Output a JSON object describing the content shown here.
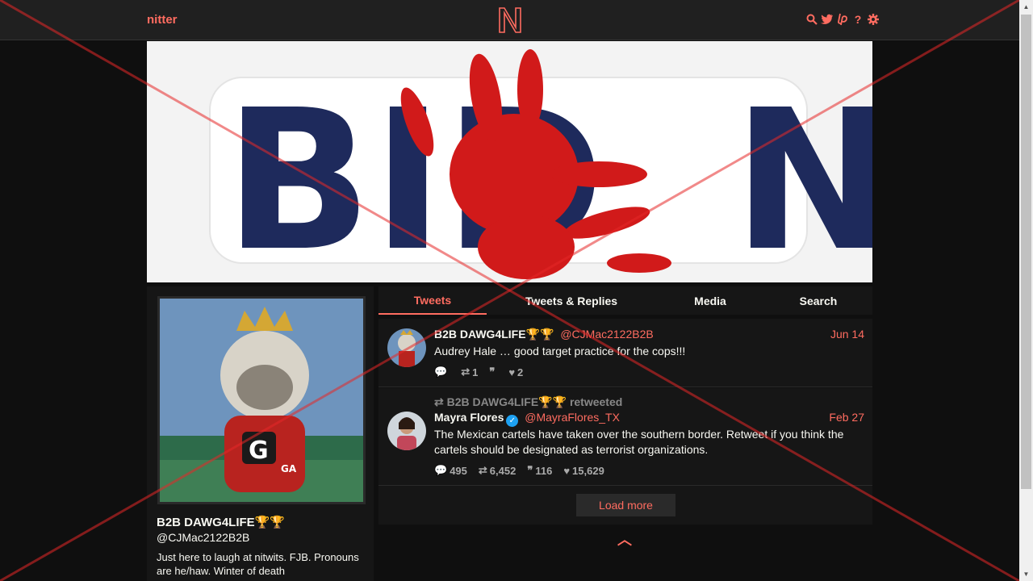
{
  "nav": {
    "brand": "nitter",
    "icons": [
      "search-icon",
      "rss-icon",
      "liberapay-icon",
      "about-icon",
      "settings-icon"
    ],
    "help_glyph": "?"
  },
  "banner": {
    "text_left": "BID",
    "text_right": "N"
  },
  "profile": {
    "fullname": "B2B DAWG4LIFE🏆🏆",
    "username": "@CJMac2122B2B",
    "bio": "Just here to laugh at nitwits. FJB. Pronouns are he/haw. Winter of death",
    "avatar_letters": "GA"
  },
  "tabs": [
    {
      "label": "Tweets",
      "active": true
    },
    {
      "label": "Tweets & Replies",
      "active": false
    },
    {
      "label": "Media",
      "active": false
    },
    {
      "label": "Search",
      "active": false
    }
  ],
  "tweets": [
    {
      "fullname": "B2B DAWG4LIFE🏆🏆",
      "username": "@CJMac2122B2B",
      "date": "Jun 14",
      "text": "Audrey Hale … good target practice for the cops!!!",
      "replies": "",
      "retweets": "1",
      "quotes": "",
      "likes": "2"
    },
    {
      "retweet_header": "B2B DAWG4LIFE🏆🏆 retweeted",
      "fullname": "Mayra Flores",
      "username": "@MayraFlores_TX",
      "date": "Feb 27",
      "text": "The Mexican cartels have taken over the southern border. Retweet if you think the cartels should be designated as terrorist organizations.",
      "replies": "495",
      "retweets": "6,452",
      "quotes": "116",
      "likes": "15,629"
    }
  ],
  "load_more": "Load more",
  "colors": {
    "accent": "#ff6c60",
    "background": "#0f0f0f",
    "panel": "#161616",
    "navbar": "#202020",
    "banner_blue": "#1e2a5c",
    "banner_red": "#d11a1a"
  }
}
